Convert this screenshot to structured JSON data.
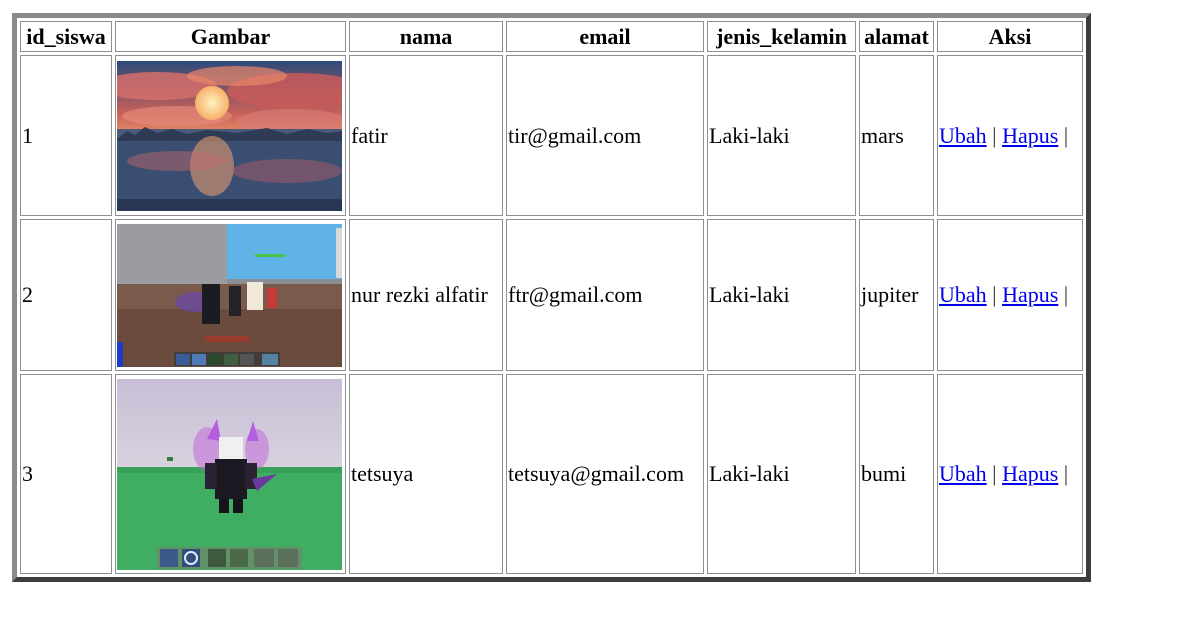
{
  "table": {
    "headers": [
      "id_siswa",
      "Gambar",
      "nama",
      "email",
      "jenis_kelamin",
      "alamat",
      "Aksi"
    ],
    "rows": [
      {
        "id": "1",
        "nama": "fatir",
        "email": "tir@gmail.com",
        "jenis_kelamin": "Laki-laki",
        "alamat": "mars",
        "image": "sunset-lake-landscape-image"
      },
      {
        "id": "2",
        "nama": "nur rezki alfatir",
        "email": "ftr@gmail.com",
        "jenis_kelamin": "Laki-laki",
        "alamat": "jupiter",
        "image": "game-screenshot-image"
      },
      {
        "id": "3",
        "nama": "tetsuya",
        "email": "tetsuya@gmail.com",
        "jenis_kelamin": "Laki-laki",
        "alamat": "bumi",
        "image": "game-character-image"
      }
    ]
  },
  "actions": {
    "edit_label": "Ubah",
    "delete_label": "Hapus",
    "separator": "|"
  },
  "colors": {
    "link": "#0000ee",
    "border_light": "#8a8a8a",
    "border_dark": "#3d3d3d"
  }
}
